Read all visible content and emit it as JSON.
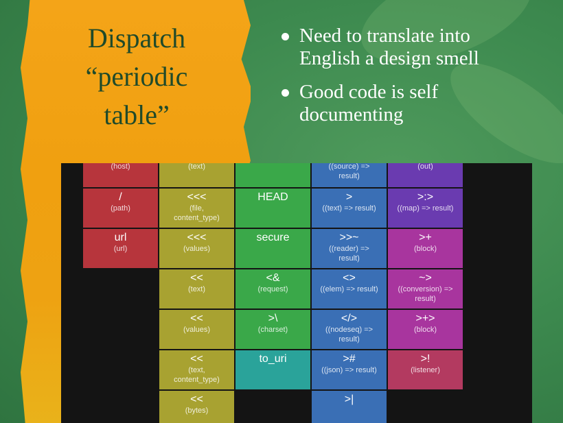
{
  "slide": {
    "title": [
      "Dispatch",
      "“periodic",
      "table”"
    ],
    "bullets": [
      [
        "Need to translate into",
        "English a design smell"
      ],
      [
        "Good code is self",
        "documenting"
      ]
    ]
  },
  "colors": {
    "red": "#b7353c",
    "olive": "#a8a231",
    "green": "#3aa849",
    "teal": "#2aa39a",
    "blue": "#3a6fb5",
    "purple": "#6a3bb0",
    "magenta": "#a8359e",
    "pink": "#b33a60"
  },
  "columns": [
    {
      "color": "red",
      "cells": [
        {
          "sym": "",
          "sub": "(host)"
        },
        {
          "sym": "/",
          "sub": "(path)"
        },
        {
          "sym": "url",
          "sub": "(url)"
        }
      ]
    },
    {
      "color": "olive",
      "cells": [
        {
          "sym": "",
          "sub": "(text)"
        },
        {
          "sym": "<<<",
          "sub": "(file,\ncontent_type)"
        },
        {
          "sym": "<<<",
          "sub": "(values)"
        },
        {
          "sym": "<<",
          "sub": "(text)"
        },
        {
          "sym": "<<",
          "sub": "(values)"
        },
        {
          "sym": "<<",
          "sub": "(text,\ncontent_type)"
        },
        {
          "sym": "<<",
          "sub": "(bytes)"
        }
      ]
    },
    {
      "color": "green",
      "cells": [
        {
          "sym": "",
          "sub": ""
        },
        {
          "sym": "HEAD",
          "sub": ""
        },
        {
          "sym": "secure",
          "sub": ""
        },
        {
          "sym": "<&",
          "sub": "(request)"
        },
        {
          "sym": ">\\",
          "sub": "(charset)"
        },
        {
          "sym": "to_uri",
          "sub": "",
          "color": "teal"
        }
      ]
    },
    {
      "color": "blue",
      "cells": [
        {
          "sym": "",
          "sub": "((source) =>\nresult)"
        },
        {
          "sym": ">",
          "sub": "((text) => result)"
        },
        {
          "sym": ">>~",
          "sub": "((reader) =>\nresult)"
        },
        {
          "sym": "<>",
          "sub": "((elem) => result)"
        },
        {
          "sym": "</>",
          "sub": "((nodeseq) =>\nresult)"
        },
        {
          "sym": ">#",
          "sub": "((json) => result)"
        },
        {
          "sym": ">|",
          "sub": ""
        }
      ]
    },
    {
      "color": "purple",
      "cells": [
        {
          "sym": "",
          "sub": "(out)"
        },
        {
          "sym": ">:>",
          "sub": "((map) => result)"
        },
        {
          "sym": ">+",
          "sub": "(block)",
          "color": "magenta"
        },
        {
          "sym": "~>",
          "sub": "((conversion) =>\nresult)",
          "color": "magenta"
        },
        {
          "sym": ">+>",
          "sub": "(block)",
          "color": "magenta"
        },
        {
          "sym": ">!",
          "sub": "(listener)",
          "color": "pink"
        }
      ]
    }
  ]
}
